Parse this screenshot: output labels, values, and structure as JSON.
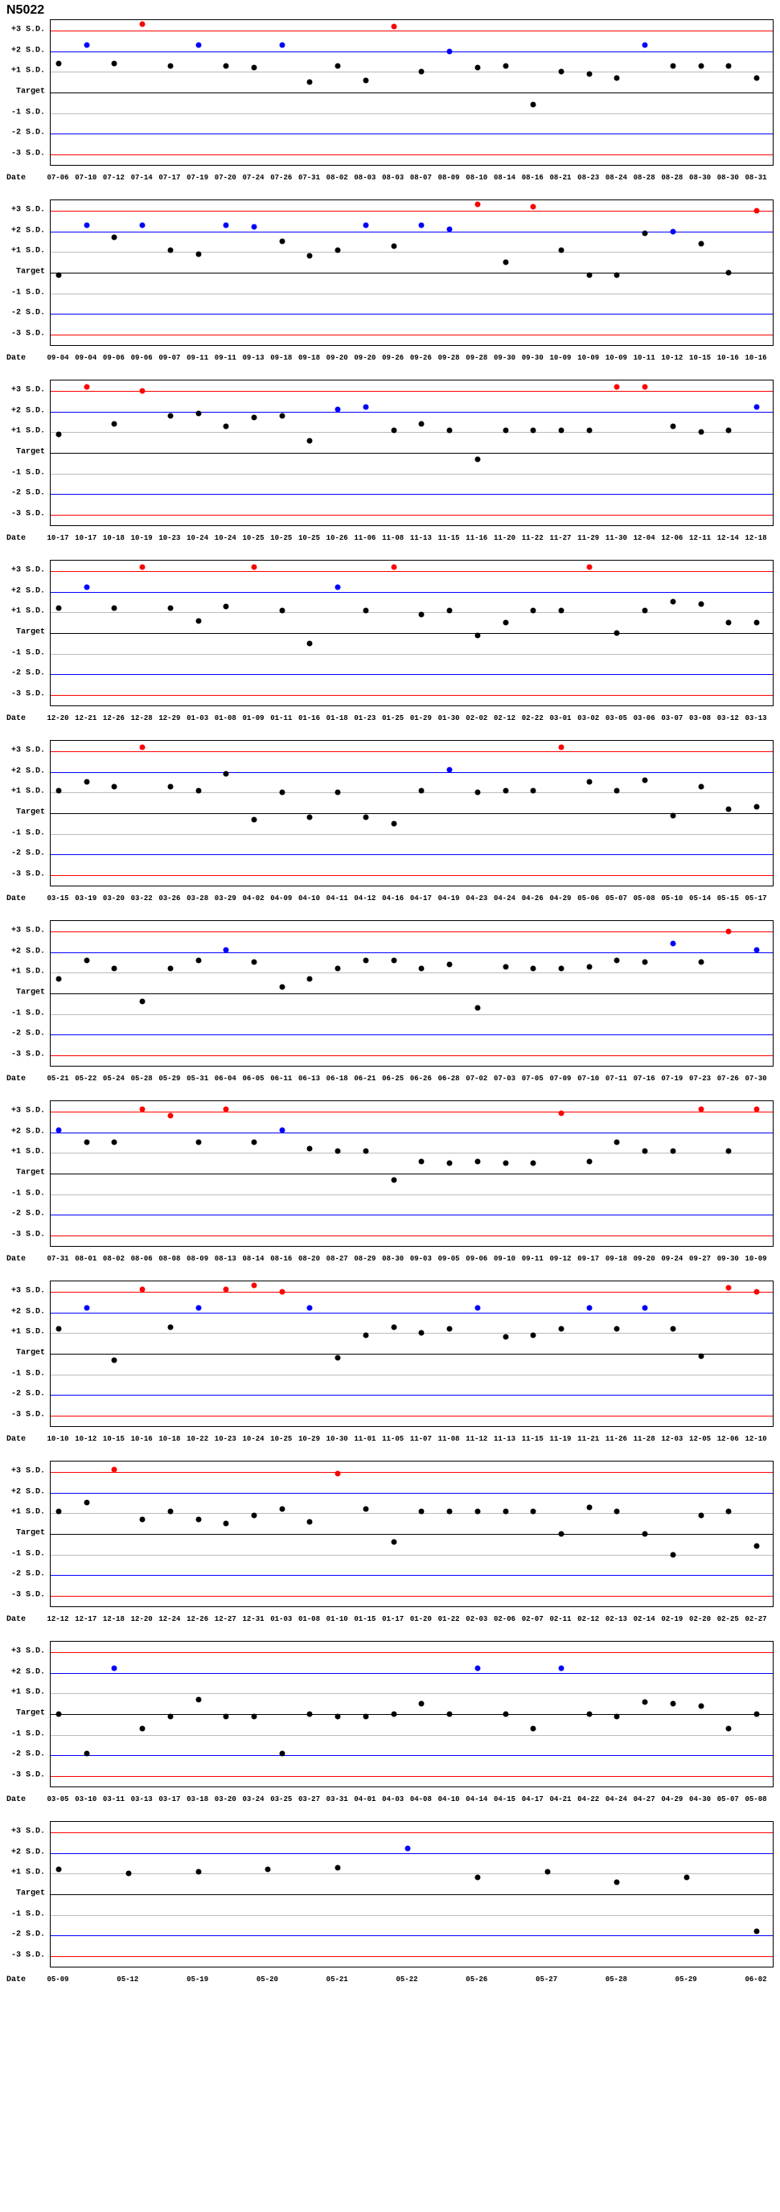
{
  "title": "N5022",
  "y_axis": {
    "labels": [
      "+3 S.D.",
      "+2 S.D.",
      "+1 S.D.",
      "Target",
      "-1 S.D.",
      "-2 S.D.",
      "-3 S.D."
    ],
    "values": [
      3,
      2,
      1,
      0,
      -1,
      -2,
      -3
    ],
    "min": -3.5,
    "max": 3.5
  },
  "x_label": "Date",
  "plot_inner_width": 888,
  "plot_inner_height": 180,
  "chart_data": [
    {
      "dates": [
        "07-06",
        "07-10",
        "07-12",
        "07-14",
        "07-17",
        "07-19",
        "07-20",
        "07-24",
        "07-26",
        "07-31",
        "08-02",
        "08-03",
        "08-03",
        "08-07",
        "08-09",
        "08-10",
        "08-14",
        "08-16",
        "08-21",
        "08-23",
        "08-24",
        "08-28",
        "08-28",
        "08-30",
        "08-30",
        "08-31"
      ],
      "values": [
        1.4,
        2.3,
        1.4,
        3.3,
        1.3,
        2.3,
        1.3,
        1.2,
        2.3,
        0.5,
        1.3,
        0.6,
        3.2,
        1.0,
        2.0,
        1.2,
        1.3,
        -0.6,
        1.0,
        0.9,
        0.7,
        2.3,
        1.3,
        1.3,
        1.3,
        0.7
      ]
    },
    {
      "dates": [
        "09-04",
        "09-04",
        "09-06",
        "09-06",
        "09-07",
        "09-11",
        "09-11",
        "09-13",
        "09-18",
        "09-18",
        "09-20",
        "09-20",
        "09-26",
        "09-26",
        "09-28",
        "09-28",
        "09-30",
        "09-30",
        "10-09",
        "10-09",
        "10-09",
        "10-11",
        "10-12",
        "10-15",
        "10-16",
        "10-16"
      ],
      "values": [
        -0.1,
        2.3,
        1.7,
        2.3,
        1.1,
        0.9,
        2.3,
        2.2,
        1.5,
        0.8,
        1.1,
        2.3,
        1.3,
        2.3,
        2.1,
        3.3,
        0.5,
        3.2,
        1.1,
        -0.1,
        -0.1,
        1.9,
        2.0,
        1.4,
        0.0,
        3.0
      ]
    },
    {
      "dates": [
        "10-17",
        "10-17",
        "10-18",
        "10-19",
        "10-23",
        "10-24",
        "10-24",
        "10-25",
        "10-25",
        "10-25",
        "10-26",
        "11-06",
        "11-08",
        "11-13",
        "11-15",
        "11-16",
        "11-20",
        "11-22",
        "11-27",
        "11-29",
        "11-30",
        "12-04",
        "12-06",
        "12-11",
        "12-14",
        "12-18"
      ],
      "values": [
        0.9,
        3.2,
        1.4,
        3.0,
        1.8,
        1.9,
        1.3,
        1.7,
        1.8,
        0.6,
        2.1,
        2.2,
        1.1,
        1.4,
        1.1,
        -0.3,
        1.1,
        1.1,
        1.1,
        1.1,
        3.2,
        3.2,
        1.3,
        1.0,
        1.1,
        2.2
      ]
    },
    {
      "dates": [
        "12-20",
        "12-21",
        "12-26",
        "12-28",
        "12-29",
        "01-03",
        "01-08",
        "01-09",
        "01-11",
        "01-16",
        "01-18",
        "01-23",
        "01-25",
        "01-29",
        "01-30",
        "02-02",
        "02-12",
        "02-22",
        "03-01",
        "03-02",
        "03-05",
        "03-06",
        "03-07",
        "03-08",
        "03-12",
        "03-13"
      ],
      "values": [
        1.2,
        2.2,
        1.2,
        3.2,
        1.2,
        0.6,
        1.3,
        3.2,
        1.1,
        -0.5,
        2.2,
        1.1,
        3.2,
        0.9,
        1.1,
        -0.1,
        0.5,
        1.1,
        1.1,
        3.2,
        0.0,
        1.1,
        1.5,
        1.4,
        0.5,
        0.5
      ]
    },
    {
      "dates": [
        "03-15",
        "03-19",
        "03-20",
        "03-22",
        "03-26",
        "03-28",
        "03-29",
        "04-02",
        "04-09",
        "04-10",
        "04-11",
        "04-12",
        "04-16",
        "04-17",
        "04-19",
        "04-23",
        "04-24",
        "04-26",
        "04-29",
        "05-06",
        "05-07",
        "05-08",
        "05-10",
        "05-14",
        "05-15",
        "05-17"
      ],
      "values": [
        1.1,
        1.5,
        1.3,
        3.2,
        1.3,
        1.1,
        1.9,
        -0.3,
        1.0,
        -0.2,
        1.0,
        -0.2,
        -0.5,
        1.1,
        2.1,
        1.0,
        1.1,
        1.1,
        3.2,
        1.5,
        1.1,
        1.6,
        -0.1,
        1.3,
        0.2,
        0.3
      ]
    },
    {
      "dates": [
        "05-21",
        "05-22",
        "05-24",
        "05-28",
        "05-29",
        "05-31",
        "06-04",
        "06-05",
        "06-11",
        "06-13",
        "06-18",
        "06-21",
        "06-25",
        "06-26",
        "06-28",
        "07-02",
        "07-03",
        "07-05",
        "07-09",
        "07-10",
        "07-11",
        "07-16",
        "07-19",
        "07-23",
        "07-26",
        "07-30"
      ],
      "values": [
        0.7,
        1.6,
        1.2,
        -0.4,
        1.2,
        1.6,
        2.1,
        1.5,
        0.3,
        0.7,
        1.2,
        1.6,
        1.6,
        1.2,
        1.4,
        -0.7,
        1.3,
        1.2,
        1.2,
        1.3,
        1.6,
        1.5,
        2.4,
        1.5,
        3.0,
        2.1
      ]
    },
    {
      "dates": [
        "07-31",
        "08-01",
        "08-02",
        "08-06",
        "08-08",
        "08-09",
        "08-13",
        "08-14",
        "08-16",
        "08-20",
        "08-27",
        "08-29",
        "08-30",
        "09-03",
        "09-05",
        "09-06",
        "09-10",
        "09-11",
        "09-12",
        "09-17",
        "09-18",
        "09-20",
        "09-24",
        "09-27",
        "09-30",
        "10-09"
      ],
      "values": [
        2.1,
        1.5,
        1.5,
        3.1,
        2.8,
        1.5,
        3.1,
        1.5,
        2.1,
        1.2,
        1.1,
        1.1,
        -0.3,
        0.6,
        0.5,
        0.6,
        0.5,
        0.5,
        2.9,
        0.6,
        1.5,
        1.1,
        1.1,
        3.1,
        1.1,
        3.1
      ]
    },
    {
      "dates": [
        "10-10",
        "10-12",
        "10-15",
        "10-16",
        "10-18",
        "10-22",
        "10-23",
        "10-24",
        "10-25",
        "10-29",
        "10-30",
        "11-01",
        "11-05",
        "11-07",
        "11-08",
        "11-12",
        "11-13",
        "11-15",
        "11-19",
        "11-21",
        "11-26",
        "11-28",
        "12-03",
        "12-05",
        "12-06",
        "12-10"
      ],
      "values": [
        1.2,
        2.2,
        -0.3,
        3.1,
        1.3,
        2.2,
        3.1,
        3.3,
        3.0,
        2.2,
        -0.2,
        0.9,
        1.3,
        1.0,
        1.2,
        2.2,
        0.8,
        0.9,
        1.2,
        2.2,
        1.2,
        2.2,
        1.2,
        -0.1,
        3.2,
        3.0
      ]
    },
    {
      "dates": [
        "12-12",
        "12-17",
        "12-18",
        "12-20",
        "12-24",
        "12-26",
        "12-27",
        "12-31",
        "01-03",
        "01-08",
        "01-10",
        "01-15",
        "01-17",
        "01-20",
        "01-22",
        "02-03",
        "02-06",
        "02-07",
        "02-11",
        "02-12",
        "02-13",
        "02-14",
        "02-19",
        "02-20",
        "02-25",
        "02-27"
      ],
      "values": [
        1.1,
        1.5,
        3.1,
        0.7,
        1.1,
        0.7,
        0.5,
        0.9,
        1.2,
        0.6,
        2.9,
        1.2,
        -0.4,
        1.1,
        1.1,
        1.1,
        1.1,
        1.1,
        0.0,
        1.3,
        1.1,
        0.0,
        -1.0,
        0.9,
        1.1,
        -0.6
      ]
    },
    {
      "dates": [
        "03-05",
        "03-10",
        "03-11",
        "03-13",
        "03-17",
        "03-18",
        "03-20",
        "03-24",
        "03-25",
        "03-27",
        "03-31",
        "04-01",
        "04-03",
        "04-08",
        "04-10",
        "04-14",
        "04-15",
        "04-17",
        "04-21",
        "04-22",
        "04-24",
        "04-27",
        "04-29",
        "04-30",
        "05-07",
        "05-08"
      ],
      "values": [
        0.0,
        -1.9,
        2.2,
        -0.7,
        -0.1,
        0.7,
        -0.1,
        -0.1,
        -1.9,
        0.0,
        -0.1,
        -0.1,
        0.0,
        0.5,
        0.0,
        2.2,
        0.0,
        -0.7,
        2.2,
        0.0,
        -0.1,
        0.6,
        0.5,
        0.4,
        -0.7,
        0.0
      ]
    },
    {
      "dates": [
        "05-09",
        "05-12",
        "05-19",
        "05-20",
        "05-21",
        "05-22",
        "05-26",
        "05-27",
        "05-28",
        "05-29",
        "06-02"
      ],
      "values": [
        1.2,
        1.0,
        1.1,
        1.2,
        1.3,
        2.2,
        0.8,
        1.1,
        0.6,
        0.8,
        -1.8
      ]
    }
  ]
}
